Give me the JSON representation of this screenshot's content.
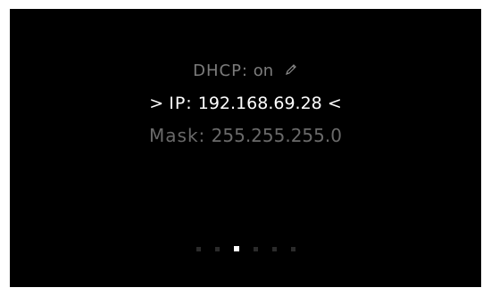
{
  "settings": {
    "dhcp": {
      "label": "DHCP:",
      "value": "on",
      "edit_icon": "pencil-icon"
    },
    "ip": {
      "prefix": ">",
      "label": "IP:",
      "value": "192.168.69.28",
      "suffix": "<"
    },
    "mask": {
      "label": "Mask:",
      "value": "255.255.255.0"
    }
  },
  "pagination": {
    "total_pages": 6,
    "active_page": 3
  },
  "colors": {
    "background": "#000000",
    "selected_text": "#ffffff",
    "dim_text": "#7c7c7c",
    "dot_inactive": "#2b2b2b",
    "dot_active": "#ffffff"
  }
}
